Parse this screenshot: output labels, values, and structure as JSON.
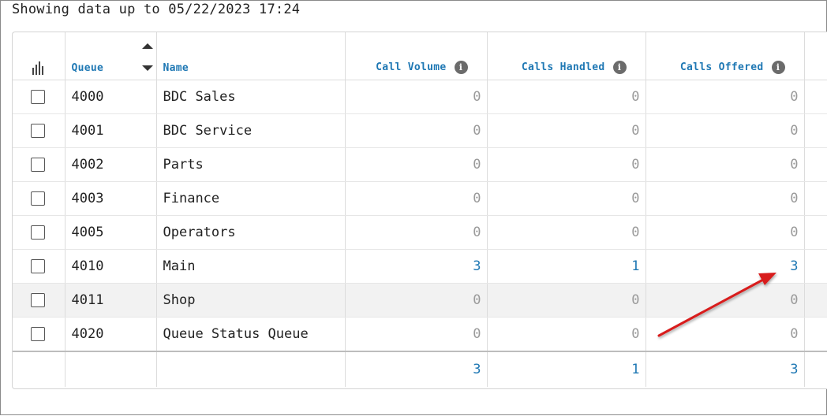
{
  "status": {
    "showing_text": "Showing data up to 05/22/2023 17:24"
  },
  "table": {
    "columns": {
      "queue": "Queue",
      "name": "Name",
      "call_volume": "Call Volume",
      "calls_handled": "Calls Handled",
      "calls_offered": "Calls Offered"
    },
    "rows": [
      {
        "queue": "4000",
        "name": "BDC Sales",
        "call_volume": "0",
        "calls_handled": "0",
        "calls_offered": "0"
      },
      {
        "queue": "4001",
        "name": "BDC Service",
        "call_volume": "0",
        "calls_handled": "0",
        "calls_offered": "0"
      },
      {
        "queue": "4002",
        "name": "Parts",
        "call_volume": "0",
        "calls_handled": "0",
        "calls_offered": "0"
      },
      {
        "queue": "4003",
        "name": "Finance",
        "call_volume": "0",
        "calls_handled": "0",
        "calls_offered": "0"
      },
      {
        "queue": "4005",
        "name": "Operators",
        "call_volume": "0",
        "calls_handled": "0",
        "calls_offered": "0"
      },
      {
        "queue": "4010",
        "name": "Main",
        "call_volume": "3",
        "calls_handled": "1",
        "calls_offered": "3"
      },
      {
        "queue": "4011",
        "name": "Shop",
        "call_volume": "0",
        "calls_handled": "0",
        "calls_offered": "0"
      },
      {
        "queue": "4020",
        "name": "Queue Status Queue",
        "call_volume": "0",
        "calls_handled": "0",
        "calls_offered": "0"
      }
    ],
    "totals": {
      "call_volume": "3",
      "calls_handled": "1",
      "calls_offered": "3"
    }
  },
  "colors": {
    "link_blue": "#1f78b4",
    "zero_gray": "#9a9a9a",
    "arrow_red": "#d81e1e"
  },
  "icons": {
    "info": "info-icon",
    "chart": "bar-chart-icon",
    "sort": "sort-icon"
  }
}
